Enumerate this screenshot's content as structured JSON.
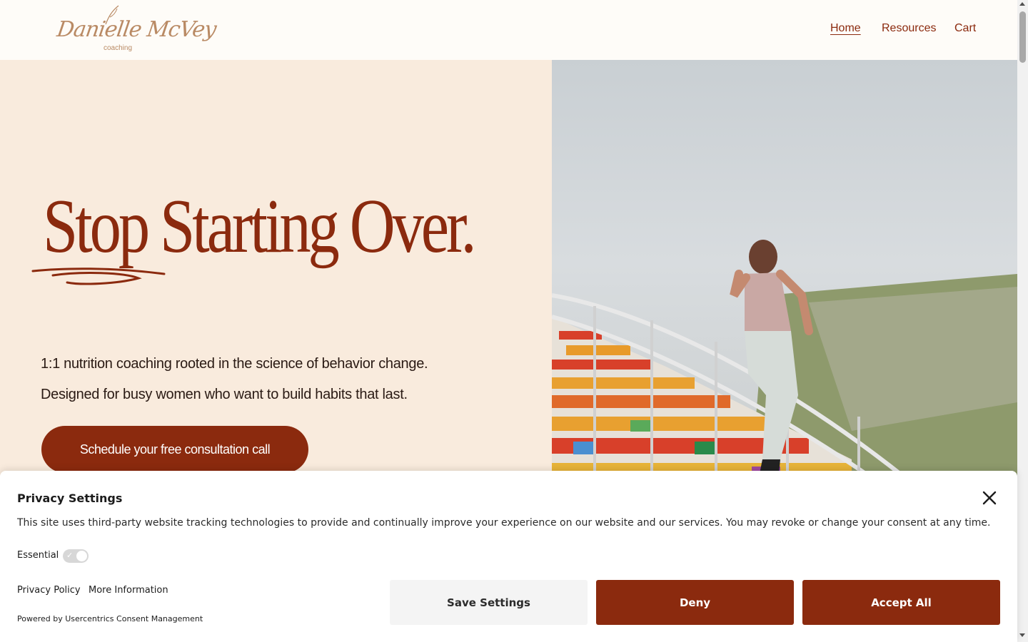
{
  "brand": {
    "logo_script": "Danielle McVey",
    "logo_sub": "coaching"
  },
  "nav": {
    "home": "Home",
    "resources": "Resources",
    "cart": "Cart"
  },
  "hero": {
    "headline": "Stop Starting Over.",
    "tagline_1": "1:1 nutrition coaching rooted in the science of behavior change.",
    "tagline_2": "Designed for busy women who want to build habits that last.",
    "cta_label": "Schedule your free consultation call"
  },
  "consent": {
    "title": "Privacy Settings",
    "description": "This site uses third-party website tracking technologies to provide and continually improve your experience on our website and our services. You may revoke or change your consent at any time.",
    "essential_label": "Essential",
    "essential_enabled": true,
    "privacy_policy_link": "Privacy Policy",
    "more_info_link": "More Information",
    "powered_by": "Powered by Usercentrics Consent Management",
    "save_label": "Save Settings",
    "deny_label": "Deny",
    "accept_label": "Accept All"
  },
  "colors": {
    "accent": "#8b2a0e",
    "hero_bg": "#f9ebdd",
    "logo": "#b98a64"
  },
  "icons": {
    "close": "close-icon",
    "toggle_check": "check-icon"
  }
}
